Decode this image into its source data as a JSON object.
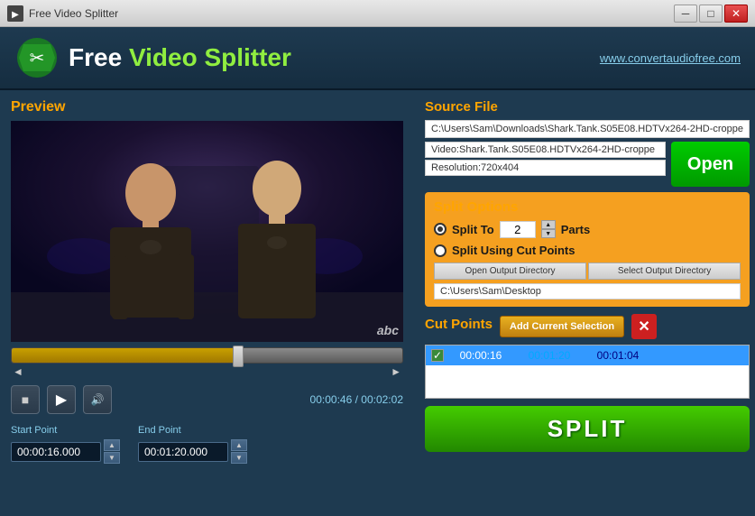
{
  "titlebar": {
    "title": "Free Video Splitter",
    "min_btn": "─",
    "max_btn": "□",
    "close_btn": "✕"
  },
  "header": {
    "app_name_free": "Free ",
    "app_name_rest": "Video Splitter",
    "website": "www.convertaudiofree.com"
  },
  "preview": {
    "label": "Preview",
    "abc_label": "abc",
    "current_time": "00:00:46",
    "total_time": "00:02:02"
  },
  "controls": {
    "stop": "■",
    "play": "▶",
    "volume": "🔊"
  },
  "points": {
    "start_label": "Start Point",
    "start_value": "00:00:16.000",
    "end_label": "End Point",
    "end_value": "00:01:20.000",
    "up": "▲",
    "down": "▼"
  },
  "source_file": {
    "section_title": "Source File",
    "path": "C:\\Users\\Sam\\Downloads\\Shark.Tank.S05E08.HDTVx264-2HD-croppe",
    "video_name": "Video:Shark.Tank.S05E08.HDTVx264-2HD-croppe",
    "resolution": "Resolution:720x404",
    "open_btn": "Open"
  },
  "split_options": {
    "section_title": "Split Options",
    "split_to_label": "Split To",
    "split_to_value": "2",
    "parts_label": "Parts",
    "split_using_label": "Split Using Cut Points",
    "open_output_btn": "Open Output Directory",
    "select_output_btn": "Select Output Directory",
    "output_path": "C:\\Users\\Sam\\Desktop",
    "spin_up": "▲",
    "spin_down": "▼"
  },
  "cut_points": {
    "section_title": "Cut Points",
    "add_btn": "Add Current Selection",
    "delete_icon": "✕",
    "rows": [
      {
        "checked": true,
        "selected": true,
        "start": "00:00:16",
        "mid": "00:01:20",
        "end": "00:01:04"
      }
    ]
  },
  "split_btn": "SPLIT"
}
